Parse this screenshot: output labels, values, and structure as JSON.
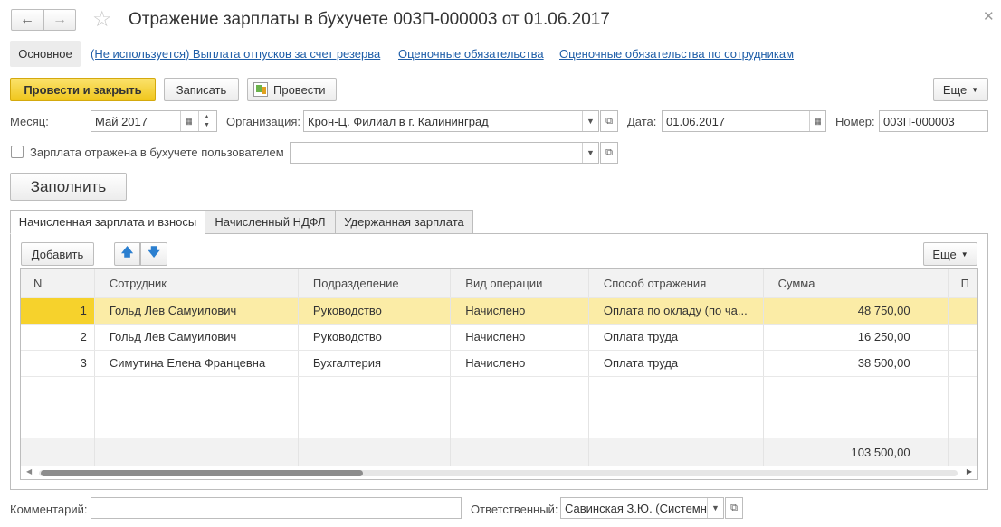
{
  "window": {
    "title": "Отражение зарплаты в бухучете 003П-000003 от 01.06.2017"
  },
  "nav": {
    "tab_main": "Основное",
    "links": [
      "(Не используется) Выплата отпусков за счет резерва",
      "Оценочные обязательства",
      "Оценочные обязательства по сотрудникам"
    ]
  },
  "toolbar": {
    "post_close": "Провести и закрыть",
    "save": "Записать",
    "post": "Провести",
    "more": "Еще"
  },
  "form": {
    "month_label": "Месяц:",
    "month_value": "Май 2017",
    "org_label": "Организация:",
    "org_value": "Крон-Ц. Филиал в г. Калининград",
    "date_label": "Дата:",
    "date_value": "01.06.2017",
    "number_label": "Номер:",
    "number_value": "003П-000003",
    "reflected_label": "Зарплата отражена в бухучете пользователем",
    "reflected_value": "",
    "fill_button": "Заполнить"
  },
  "tabs": [
    "Начисленная зарплата и взносы",
    "Начисленный НДФЛ",
    "Удержанная зарплата"
  ],
  "table_toolbar": {
    "add": "Добавить",
    "more": "Еще"
  },
  "table": {
    "columns": [
      "N",
      "Сотрудник",
      "Подразделение",
      "Вид операции",
      "Способ отражения",
      "Сумма",
      "П"
    ],
    "rows": [
      {
        "n": "1",
        "employee": "Гольд Лев Самуилович",
        "dept": "Руководство",
        "op": "Начислено",
        "method": "Оплата по окладу (по ча...",
        "sum": "48 750,00"
      },
      {
        "n": "2",
        "employee": "Гольд Лев Самуилович",
        "dept": "Руководство",
        "op": "Начислено",
        "method": "Оплата труда",
        "sum": "16 250,00"
      },
      {
        "n": "3",
        "employee": "Симутина Елена Францевна",
        "dept": "Бухгалтерия",
        "op": "Начислено",
        "method": "Оплата труда",
        "sum": "38 500,00"
      }
    ],
    "total": "103 500,00"
  },
  "footer": {
    "comment_label": "Комментарий:",
    "comment_value": "",
    "responsible_label": "Ответственный:",
    "responsible_value": "Савинская З.Ю. (Системн"
  },
  "colors": {
    "accent": "#f6d22c",
    "selected_row": "#fbeca6",
    "link": "#1f5ea8"
  }
}
